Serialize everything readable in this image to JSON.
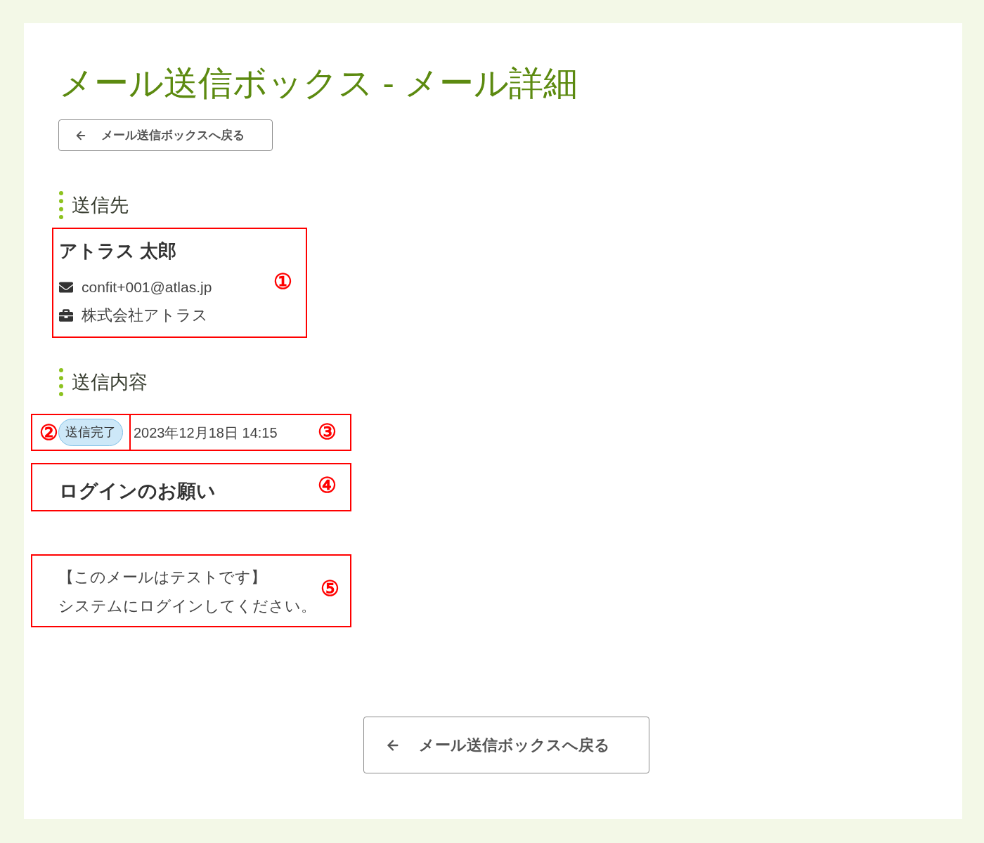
{
  "page": {
    "title": "メール送信ボックス - メール詳細",
    "back_button": "メール送信ボックスへ戻る"
  },
  "recipient_section": {
    "heading": "送信先",
    "name": "アトラス 太郎",
    "email": "confit+001@atlas.jp",
    "company": "株式会社アトラス"
  },
  "content_section": {
    "heading": "送信内容",
    "status": "送信完了",
    "sent_at": "2023年12月18日 14:15",
    "subject": "ログインのお願い",
    "body": [
      "【このメールはテストです】",
      "システムにログインしてください。"
    ]
  },
  "footer": {
    "back_button": "メール送信ボックスへ戻る"
  },
  "annotation_markers": [
    "①",
    "②",
    "③",
    "④",
    "⑤"
  ]
}
